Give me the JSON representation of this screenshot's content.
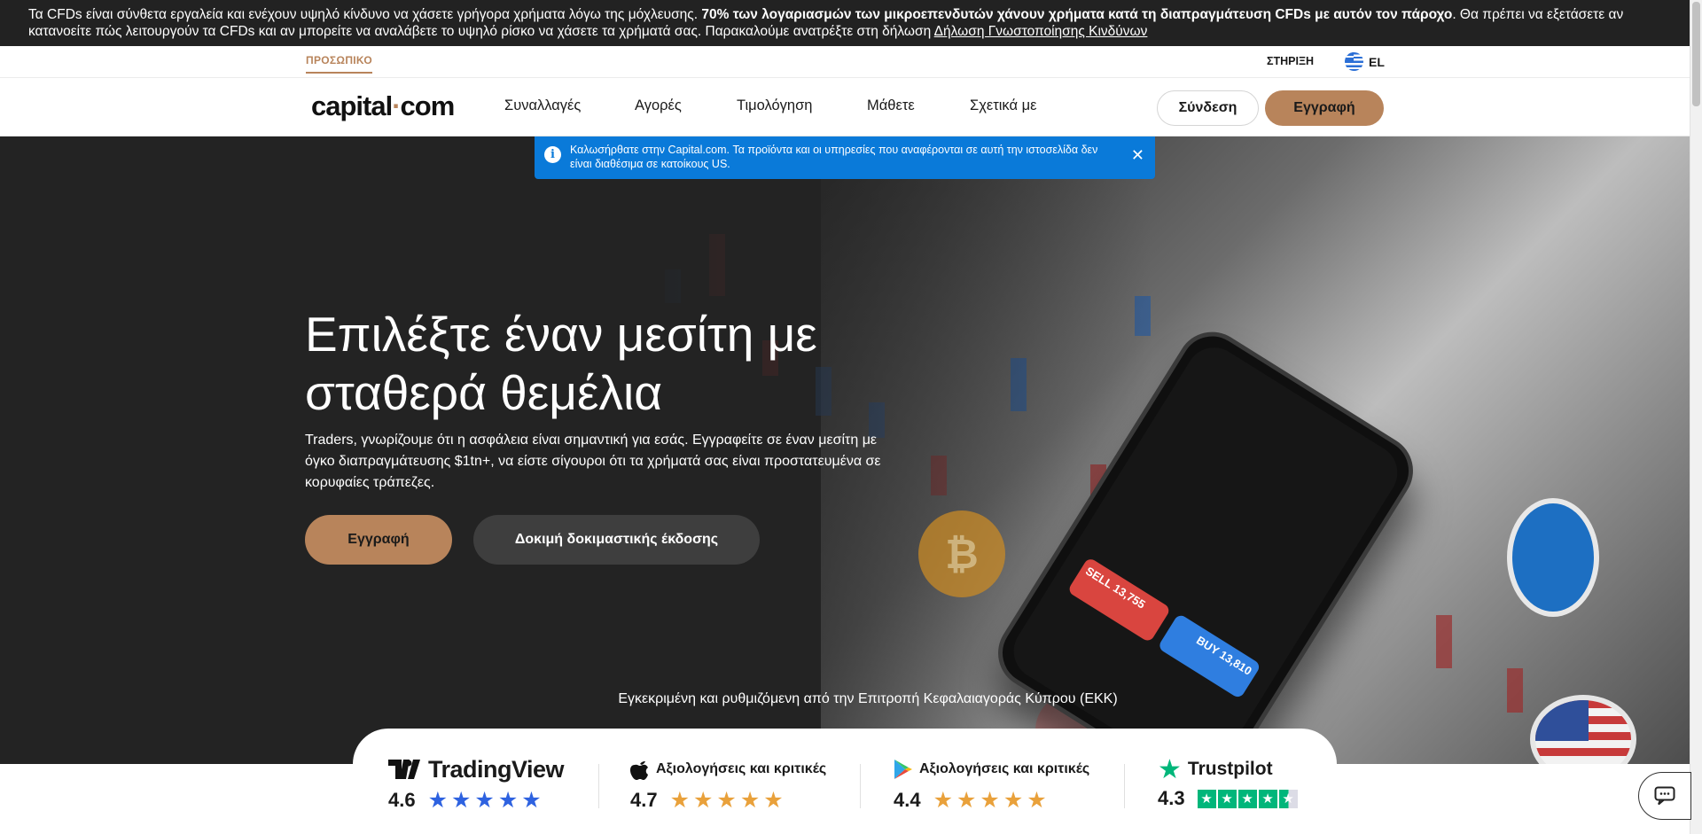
{
  "risk_warning": {
    "part1": "Τα CFDs είναι σύνθετα εργαλεία και ενέχουν υψηλό κίνδυνο να χάσετε γρήγορα χρήματα λόγω της μόχλευσης. ",
    "bold": "70% των λογαριασμών των μικροεπενδυτών χάνουν χρήματα κατά τη διαπραγμάτευση CFDs με αυτόν τον πάροχο",
    "part2": ". Θα πρέπει να εξετάσετε αν κατανοείτε πώς λειτουργούν τα CFDs και αν μπορείτε να αναλάβετε το υψηλό ρίσκο να χάσετε τα χρήματά σας. Παρακαλούμε ανατρέξτε στη δήλωση ",
    "link": "Δήλωση Γνωστοποίησης Κινδύνων"
  },
  "utility": {
    "personal_tab": "ΠΡΟΣΩΠΙΚΟ",
    "support": "ΣΤΗΡΙΞΗ",
    "language": "EL",
    "flag_icon": "greece-flag-icon"
  },
  "nav": {
    "logo_left": "capital",
    "logo_dot": "·",
    "logo_right": "com",
    "items": [
      "Συναλλαγές",
      "Αγορές",
      "Τιμολόγηση",
      "Μάθετε",
      "Σχετικά με"
    ],
    "login": "Σύνδεση",
    "register": "Εγγραφή"
  },
  "notice": {
    "text": "Καλωσήρθατε στην Capital.com. Τα προϊόντα και οι υπηρεσίες που αναφέρονται σε αυτή την ιστοσελίδα δεν είναι διαθέσιμα σε κατοίκους US.",
    "info_icon": "i",
    "close_icon": "✕"
  },
  "hero": {
    "title_line1": "Επιλέξτε έναν μεσίτη με",
    "title_line2": "σταθερά θεμέλια",
    "text": "Traders, γνωρίζουμε ότι η ασφάλεια είναι σημαντική για εσάς. Εγγραφείτε σε έναν μεσίτη με όγκο διαπραγμάτευσης $1tn+, να είστε σίγουροι ότι τα χρήματά σας είναι προστατευμένα σε κορυφαίες τράπεζες.",
    "register": "Εγγραφή",
    "demo": "Δοκιμή δοκιμαστικής έκδοσης",
    "regulator": "Εγκεκριμένη και ρυθμιζόμενη από την Επιτροπή Κεφαλαιαγοράς Κύπρου (ΕΚΚ)",
    "phone_sell": "SELL 13,755",
    "phone_buy": "BUY 13,810",
    "coin_btc": "₿"
  },
  "ratings": [
    {
      "name": "TradingView",
      "icon": "tradingview-icon",
      "score": "4.6",
      "stars": "★★★★★"
    },
    {
      "name": "Αξιολογήσεις και κριτικές",
      "icon": "apple-icon",
      "score": "4.7",
      "stars": "★★★★★"
    },
    {
      "name": "Αξιολογήσεις και κριτικές",
      "icon": "google-play-icon",
      "score": "4.4",
      "stars": "★★★★★"
    },
    {
      "name": "Trustpilot",
      "icon": "trustpilot-star-icon",
      "score": "4.3",
      "stars": "★"
    }
  ],
  "colors": {
    "accent": "#b8845b",
    "notice_blue": "#0a7ad9",
    "hero_bg": "#232323",
    "trustpilot_green": "#00b67a"
  },
  "chat": {
    "icon": "chat-icon"
  }
}
